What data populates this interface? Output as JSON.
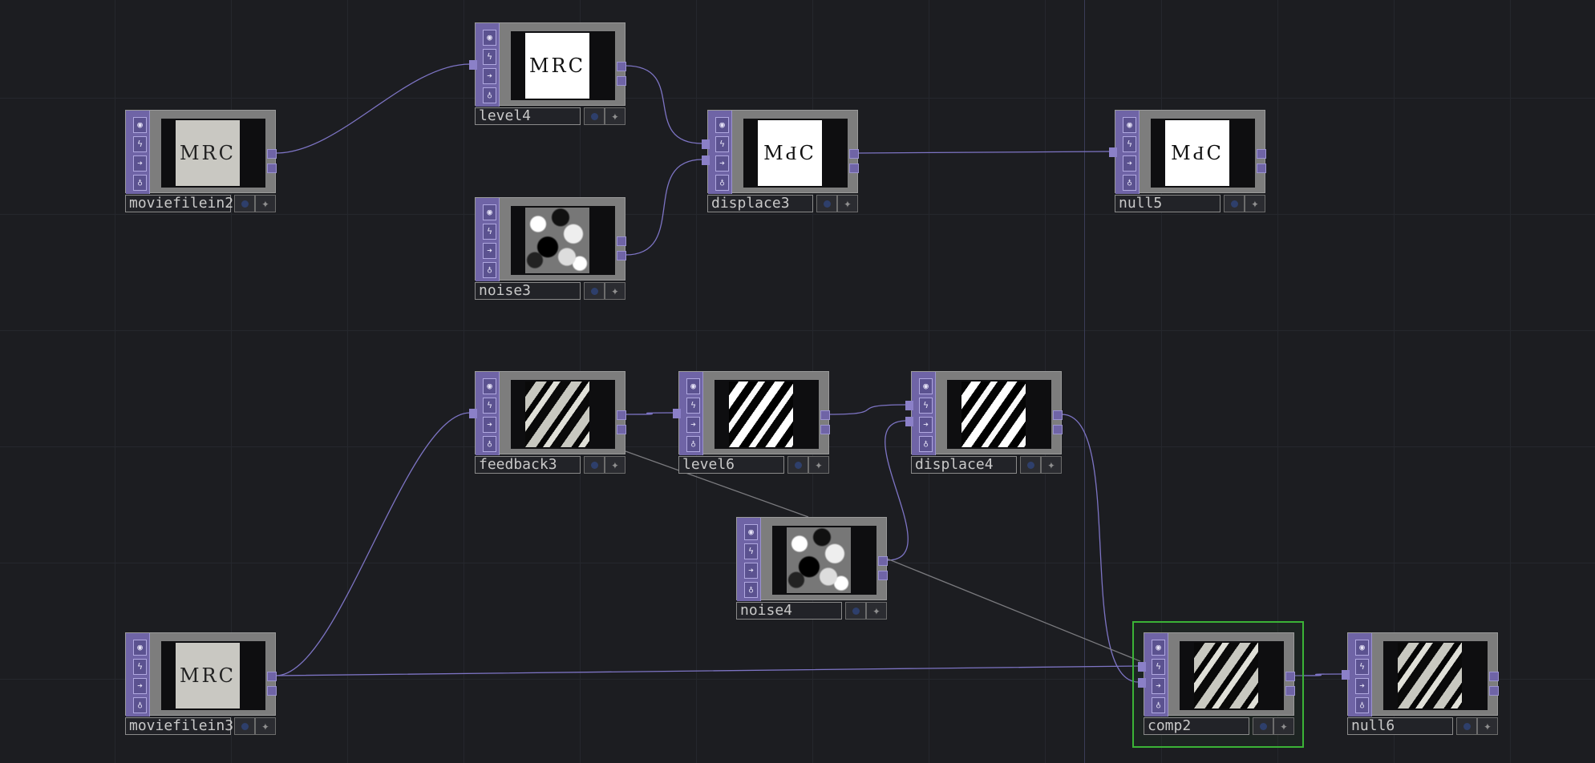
{
  "network": {
    "nodes": [
      {
        "id": "moviefilein2",
        "label": "moviefilein2",
        "image": "paper",
        "text": "MRC"
      },
      {
        "id": "level4",
        "label": "level4",
        "image": "white",
        "text": "MRC"
      },
      {
        "id": "noise3",
        "label": "noise3",
        "image": "noise",
        "text": ""
      },
      {
        "id": "displace3",
        "label": "displace3",
        "image": "white",
        "text": "MԀC"
      },
      {
        "id": "null5",
        "label": "null5",
        "image": "white",
        "text": "MԀC"
      },
      {
        "id": "feedback3",
        "label": "feedback3",
        "image": "stripes-gray",
        "text": ""
      },
      {
        "id": "level6",
        "label": "level6",
        "image": "stripes-bw",
        "text": ""
      },
      {
        "id": "displace4",
        "label": "displace4",
        "image": "stripes-bw",
        "text": ""
      },
      {
        "id": "noise4",
        "label": "noise4",
        "image": "noise",
        "text": ""
      },
      {
        "id": "moviefilein3",
        "label": "moviefilein3",
        "image": "paper",
        "text": "MRC"
      },
      {
        "id": "comp2",
        "label": "comp2",
        "image": "stripes-gray",
        "text": "",
        "selected": true
      },
      {
        "id": "null6",
        "label": "null6",
        "image": "stripes-gray",
        "text": ""
      }
    ],
    "flag_icons": [
      "viewer-icon",
      "lock-icon",
      "bypass-icon",
      "cook-icon"
    ],
    "colors": {
      "background": "#1c1d21",
      "node_strip": "#6f64a6",
      "wire": "#7d74c4",
      "selected": "#3bb336"
    }
  }
}
